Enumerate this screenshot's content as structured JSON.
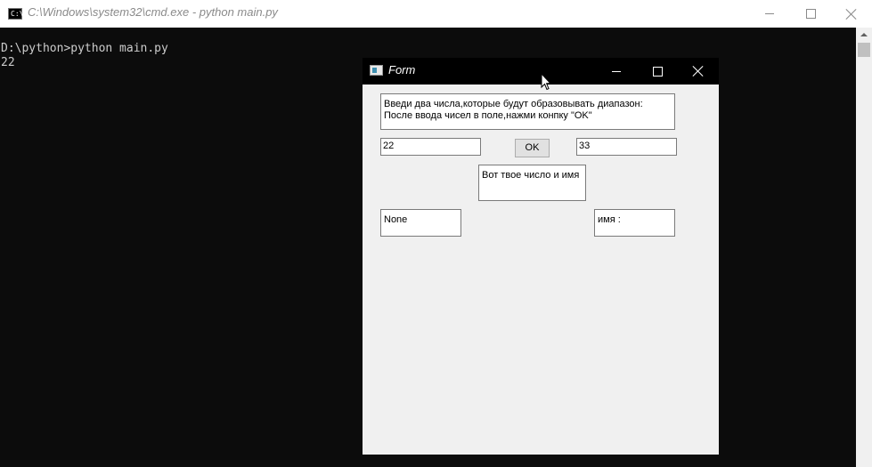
{
  "cmd": {
    "title": "C:\\Windows\\system32\\cmd.exe - python  main.py",
    "icon_text": "C:\\",
    "lines": [
      "D:\\python>python main.py",
      "22"
    ]
  },
  "form": {
    "title": "Form",
    "instructions": [
      "Введи два числа,которые будут образовывать диапазон:",
      "После ввода чисел в поле,нажми конпку \"OK\""
    ],
    "from_value": "22",
    "to_value": "33",
    "ok_label": "OK",
    "result_caption": "Вот твое число и имя",
    "number_output": "None",
    "name_output": "имя :"
  },
  "colors": {
    "console_bg": "#0c0c0c",
    "console_text": "#cccccc",
    "form_bg": "#f0f0f0",
    "form_titlebar": "#000000"
  }
}
